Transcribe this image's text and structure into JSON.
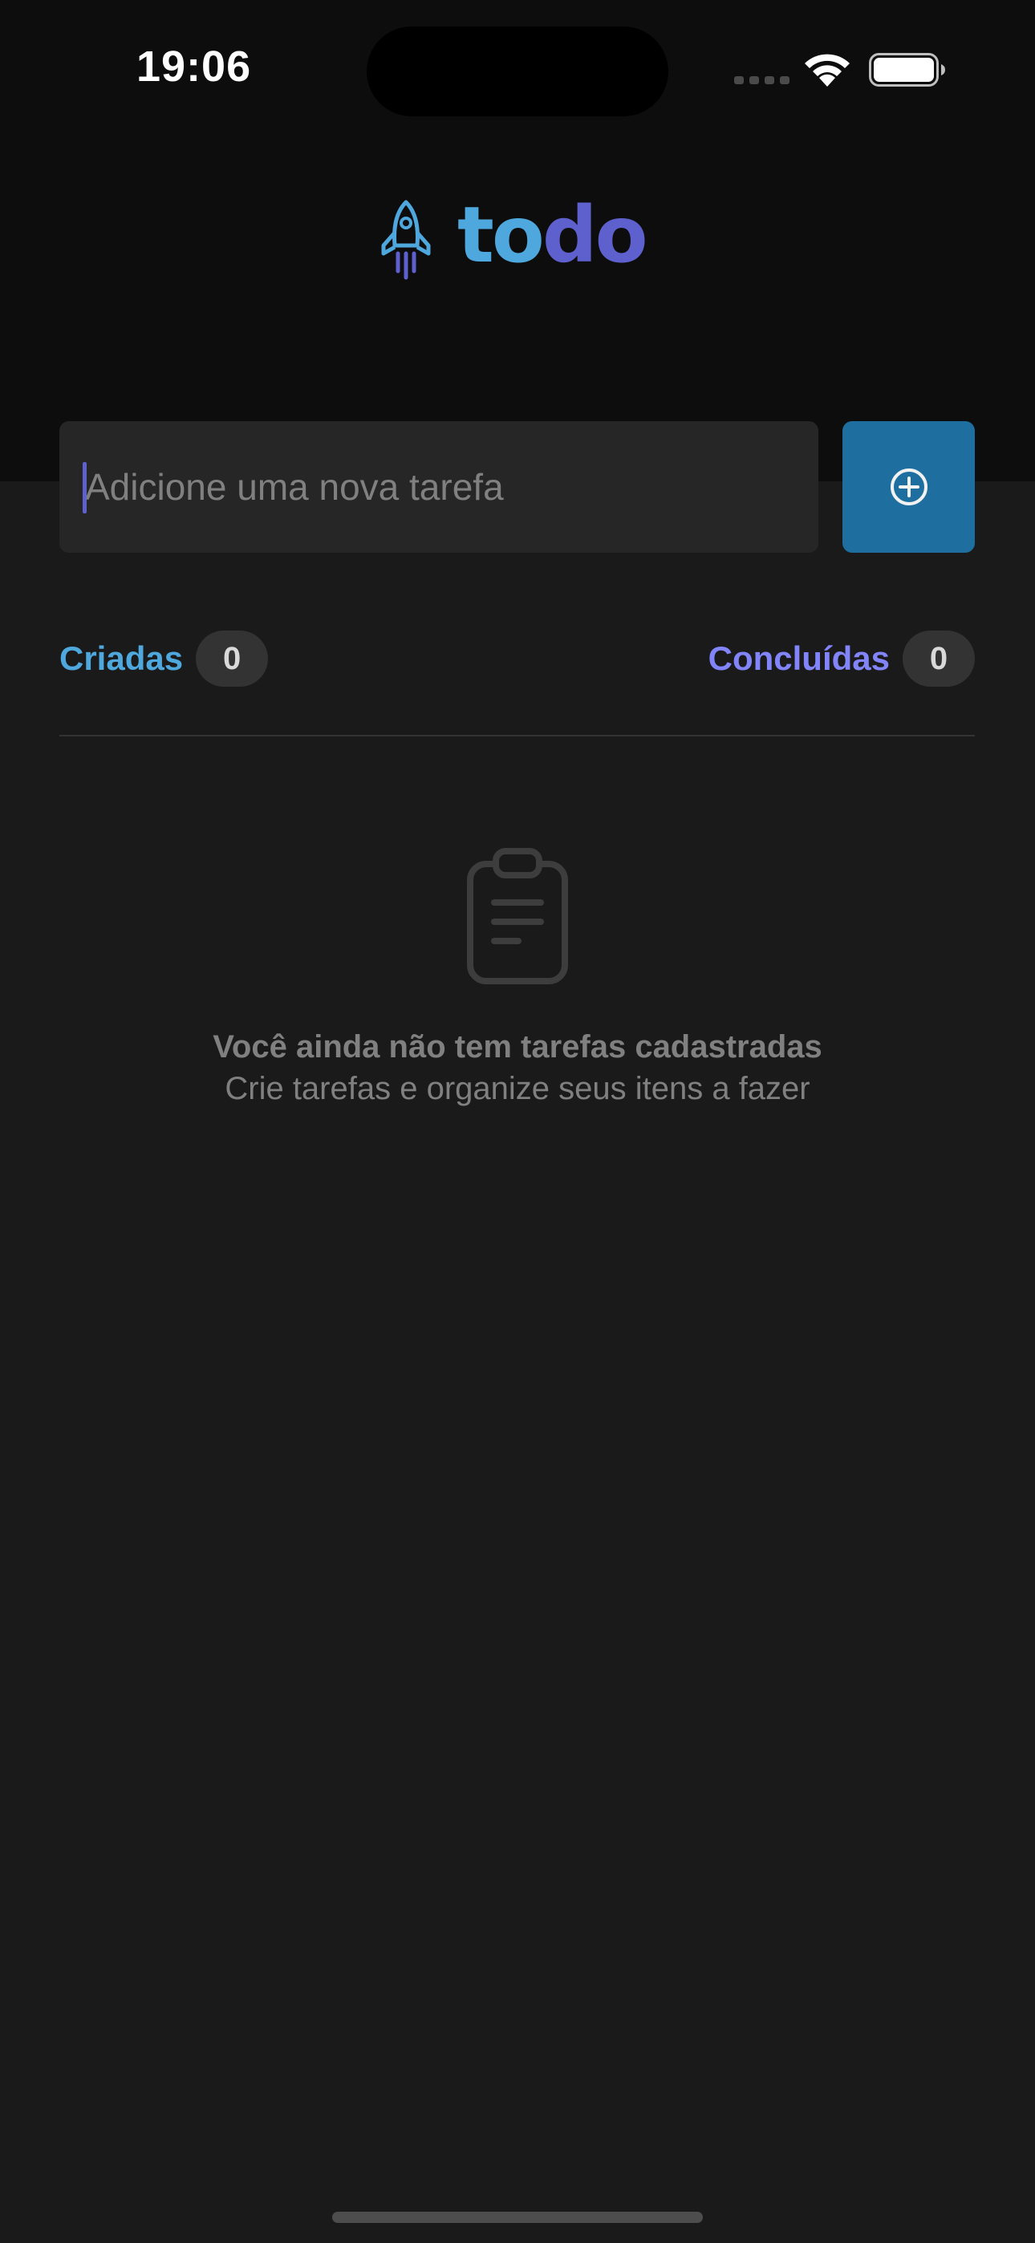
{
  "status_bar": {
    "time": "19:06"
  },
  "header": {
    "logo_part1": "to",
    "logo_part2": "do",
    "logo_icon": "rocket-icon"
  },
  "task_form": {
    "placeholder": "Adicione uma nova tarefa",
    "value": "",
    "add_icon": "plus-circle-icon"
  },
  "counters": {
    "created_label": "Criadas",
    "created_count": "0",
    "done_label": "Concluídas",
    "done_count": "0"
  },
  "empty_state": {
    "icon": "clipboard-icon",
    "title": "Você ainda não tem tarefas cadastradas",
    "subtitle": "Crie tarefas e organize seus itens a fazer"
  },
  "colors": {
    "background": "#1a1a1a",
    "header_background": "#0d0d0d",
    "input_background": "#262626",
    "button_background": "#1e6f9f",
    "blue": "#4ea8de",
    "purple": "#5e60ce",
    "purple_light": "#8284fa",
    "gray_text": "#808080",
    "badge_background": "#333333"
  }
}
